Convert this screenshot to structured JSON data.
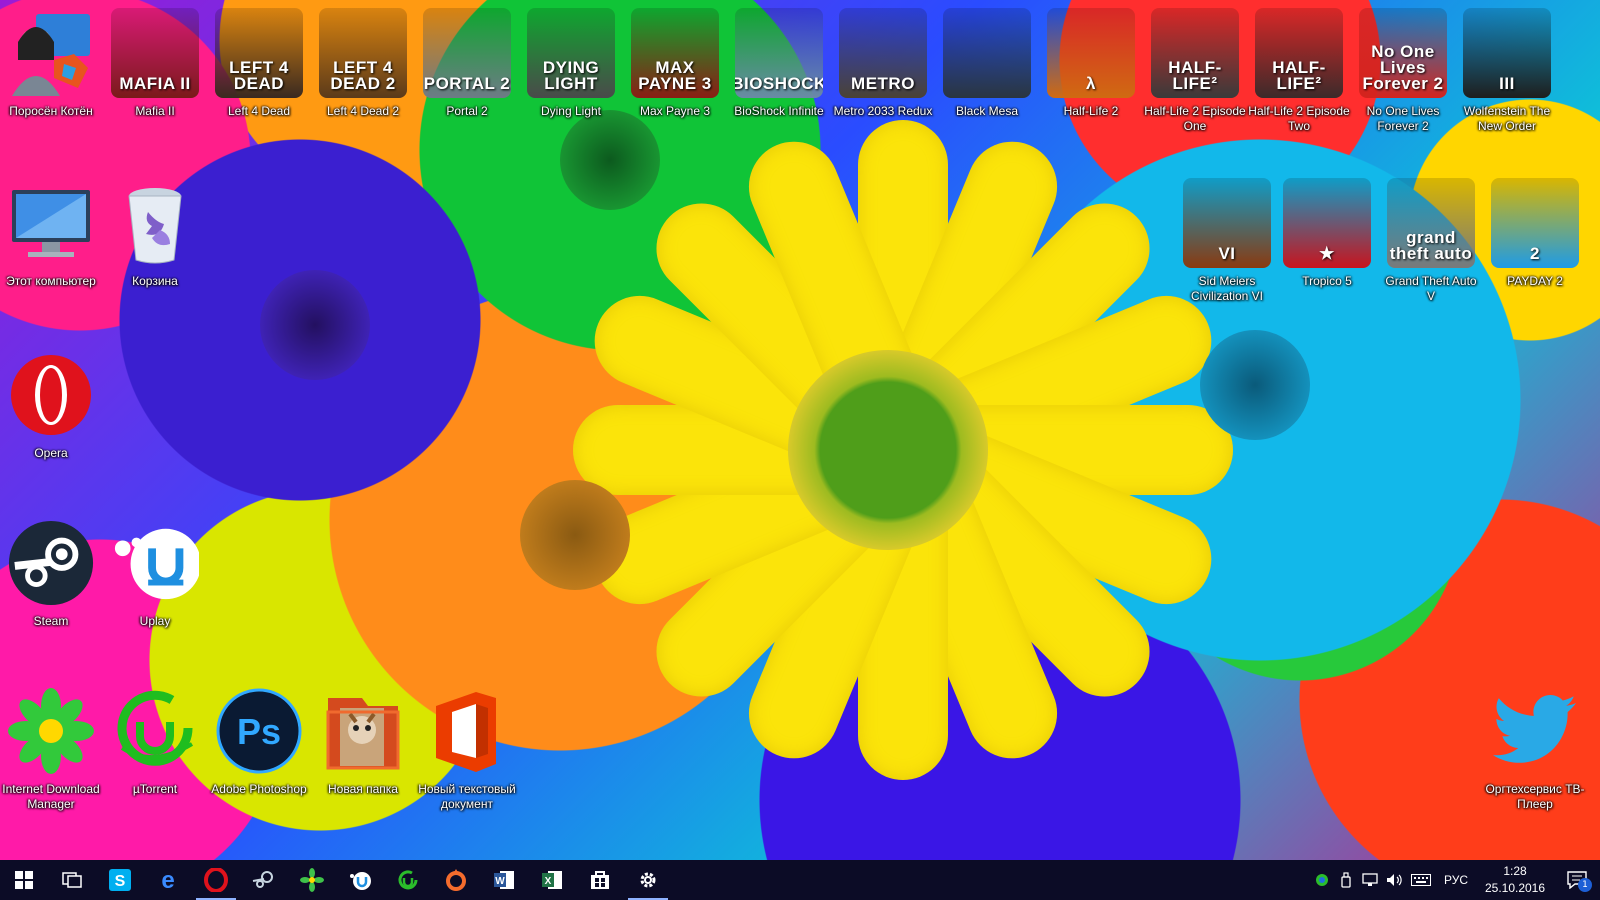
{
  "desktop": {
    "row1": [
      {
        "label": "Поросён Котён",
        "icon": "user-accounts-icon"
      },
      {
        "label": "Mafia II",
        "icon": "mafia-2-icon",
        "cover_text": "MAFIA II",
        "color": "#7a1a1a"
      },
      {
        "label": "Left 4 Dead",
        "icon": "left-4-dead-icon",
        "cover_text": "LEFT 4 DEAD",
        "color": "#3a2a20"
      },
      {
        "label": "Left 4 Dead 2",
        "icon": "left-4-dead-2-icon",
        "cover_text": "LEFT 4 DEAD 2",
        "color": "#5b3a1a"
      },
      {
        "label": "Portal 2",
        "icon": "portal-2-icon",
        "cover_text": "PORTAL 2",
        "color": "#6e7b86"
      },
      {
        "label": "Dying Light",
        "icon": "dying-light-icon",
        "cover_text": "DYING LIGHT",
        "color": "#4a4a4a"
      },
      {
        "label": "Max Payne 3",
        "icon": "max-payne-3-icon",
        "cover_text": "MAX PAYNE 3",
        "color": "#8a1e14"
      },
      {
        "label": "BioShock Infinite",
        "icon": "bioshock-infinite-icon",
        "cover_text": "BIOSHOCK",
        "color": "#6a8aa6"
      },
      {
        "label": "Metro 2033 Redux",
        "icon": "metro-2033-redux-icon",
        "cover_text": "METRO",
        "color": "#4a4236"
      },
      {
        "label": "Black Mesa",
        "icon": "black-mesa-icon",
        "cover_text": "",
        "color": "#2a3540"
      },
      {
        "label": "Half-Life 2",
        "icon": "half-life-2-icon",
        "cover_text": "λ",
        "color": "#d06a12"
      },
      {
        "label": "Half-Life 2 Episode One",
        "icon": "half-life-2-ep1-icon",
        "cover_text": "HALF-LIFE²",
        "color": "#3a3a3a"
      },
      {
        "label": "Half-Life 2 Episode Two",
        "icon": "half-life-2-ep2-icon",
        "cover_text": "HALF-LIFE²",
        "color": "#3c2a2a"
      },
      {
        "label": "No One Lives Forever 2",
        "icon": "nolf2-icon",
        "cover_text": "No One Lives Forever 2",
        "color": "#d4241e"
      },
      {
        "label": "Wolfenstein The New Order",
        "icon": "wolfenstein-icon",
        "cover_text": "III",
        "color": "#1e1e1e"
      }
    ],
    "row2_left": [
      {
        "label": "Этот компьютер",
        "icon": "this-pc-icon"
      },
      {
        "label": "Корзина",
        "icon": "recycle-bin-icon"
      }
    ],
    "row2_right": [
      {
        "label": "Sid Meiers Civilization VI",
        "icon": "civilization-6-icon",
        "cover_text": "VI",
        "color": "#8a3a10"
      },
      {
        "label": "Tropico 5",
        "icon": "tropico-5-icon",
        "cover_text": "★",
        "color": "#c8141e"
      },
      {
        "label": "Grand Theft Auto V",
        "icon": "gta-5-icon",
        "cover_text": "grand theft auto",
        "color": "#7a7a7a"
      },
      {
        "label": "PAYDAY 2",
        "icon": "payday-2-icon",
        "cover_text": "2",
        "color": "#1e9be6"
      }
    ],
    "opera": {
      "label": "Opera",
      "icon": "opera-icon"
    },
    "steam": {
      "label": "Steam",
      "icon": "steam-icon"
    },
    "uplay": {
      "label": "Uplay",
      "icon": "uplay-icon"
    },
    "bottom_row": [
      {
        "label": "Internet Download Manager",
        "icon": "idm-icon"
      },
      {
        "label": "µTorrent",
        "icon": "utorrent-icon"
      },
      {
        "label": "Adobe Photoshop",
        "icon": "photoshop-icon"
      },
      {
        "label": "Новая папка",
        "icon": "folder-icon"
      },
      {
        "label": "Новый текстовый документ",
        "icon": "office-document-icon"
      }
    ],
    "twitter": {
      "label": "Оргтехсервис ТВ-Плеер",
      "icon": "twitter-bird-icon"
    }
  },
  "taskbar": {
    "apps": [
      {
        "name": "start-icon"
      },
      {
        "name": "task-view-icon"
      },
      {
        "name": "skype-icon"
      },
      {
        "name": "edge-icon"
      },
      {
        "name": "opera-taskbar-icon",
        "active": true
      },
      {
        "name": "steam-taskbar-icon"
      },
      {
        "name": "idm-taskbar-icon"
      },
      {
        "name": "uplay-taskbar-icon"
      },
      {
        "name": "utorrent-taskbar-icon"
      },
      {
        "name": "origin-taskbar-icon"
      },
      {
        "name": "word-icon"
      },
      {
        "name": "excel-icon"
      },
      {
        "name": "store-icon"
      },
      {
        "name": "settings-icon",
        "active": true
      }
    ],
    "tray": {
      "language": "РУС",
      "time": "1:28",
      "date": "25.10.2016",
      "notification_count": "1"
    }
  },
  "colors": {
    "taskbar": "#0c0c26",
    "accent": "#8fb3ff",
    "sun_flower": "#fbe40a"
  }
}
